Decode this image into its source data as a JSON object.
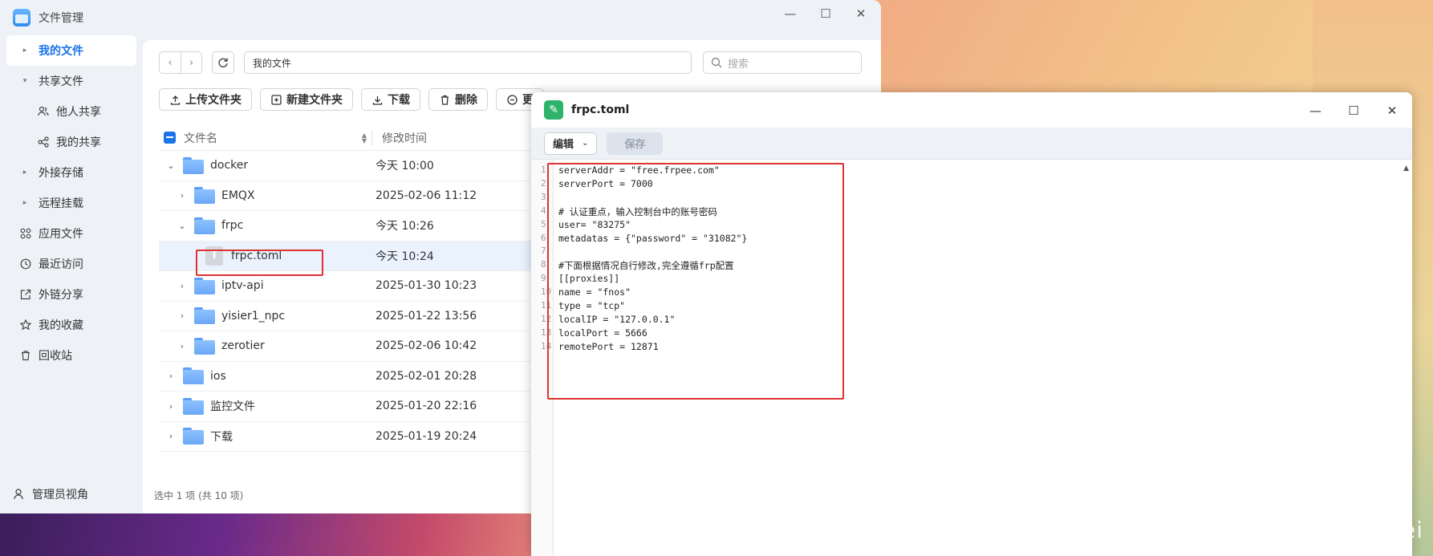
{
  "file_manager": {
    "title": "文件管理",
    "sidebar": [
      {
        "label": "我的文件",
        "icon": "caret-icon",
        "active": true
      },
      {
        "label": "共享文件",
        "icon": "caret-down-icon"
      },
      {
        "label": "他人共享",
        "icon": "users-icon",
        "sub": true
      },
      {
        "label": "我的共享",
        "icon": "share-icon",
        "sub": true
      },
      {
        "label": "外接存储",
        "icon": "caret-icon"
      },
      {
        "label": "远程挂载",
        "icon": "caret-icon"
      },
      {
        "label": "应用文件",
        "icon": "apps-icon"
      },
      {
        "label": "最近访问",
        "icon": "clock-icon"
      },
      {
        "label": "外链分享",
        "icon": "link-share-icon"
      },
      {
        "label": "我的收藏",
        "icon": "star-icon"
      },
      {
        "label": "回收站",
        "icon": "trash-icon"
      }
    ],
    "footer_label": "管理员视角",
    "path": "我的文件",
    "search_placeholder": "搜索",
    "toolbar": {
      "upload": "上传文件夹",
      "new_folder": "新建文件夹",
      "download": "下载",
      "delete": "删除",
      "more": "更"
    },
    "columns": {
      "name": "文件名",
      "time": "修改时间"
    },
    "rows": [
      {
        "name": "docker",
        "time": "今天 10:00",
        "level": 0,
        "caret": "⌄",
        "type": "folder"
      },
      {
        "name": "EMQX",
        "time": "2025-02-06 11:12",
        "level": 1,
        "caret": "›",
        "type": "folder"
      },
      {
        "name": "frpc",
        "time": "今天 10:26",
        "level": 1,
        "caret": "⌄",
        "type": "folder"
      },
      {
        "name": "frpc.toml",
        "time": "今天 10:24",
        "level": 2,
        "caret": "",
        "type": "file",
        "selected": true
      },
      {
        "name": "iptv-api",
        "time": "2025-01-30 10:23",
        "level": 1,
        "caret": "›",
        "type": "folder"
      },
      {
        "name": "yisier1_npc",
        "time": "2025-01-22 13:56",
        "level": 1,
        "caret": "›",
        "type": "folder"
      },
      {
        "name": "zerotier",
        "time": "2025-02-06 10:42",
        "level": 1,
        "caret": "›",
        "type": "folder"
      },
      {
        "name": "ios",
        "time": "2025-02-01 20:28",
        "level": 0,
        "caret": "›",
        "type": "folder"
      },
      {
        "name": "监控文件",
        "time": "2025-01-20 22:16",
        "level": 0,
        "caret": "›",
        "type": "folder"
      },
      {
        "name": "下载",
        "time": "2025-01-19 20:24",
        "level": 0,
        "caret": "›",
        "type": "folder"
      }
    ],
    "status": "选中 1 项 (共 10 项)"
  },
  "editor": {
    "title": "frpc.toml",
    "edit_label": "编辑",
    "save_label": "保存",
    "lines": [
      "serverAddr = \"free.frpee.com\"",
      "serverPort = 7000",
      "",
      "# 认证重点，输入控制台中的账号密码",
      "user= \"83275\"",
      "metadatas = {\"password\" = \"31082\"}",
      "",
      "#下面根据情况自行修改,完全遵循frp配置",
      "[[proxies]]",
      "name = \"fnos\"",
      "type = \"tcp\"",
      "localIP = \"127.0.0.1\"",
      "localPort = 5666",
      "remotePort = 12871"
    ]
  },
  "watermark": "CSDN @事在人wei"
}
